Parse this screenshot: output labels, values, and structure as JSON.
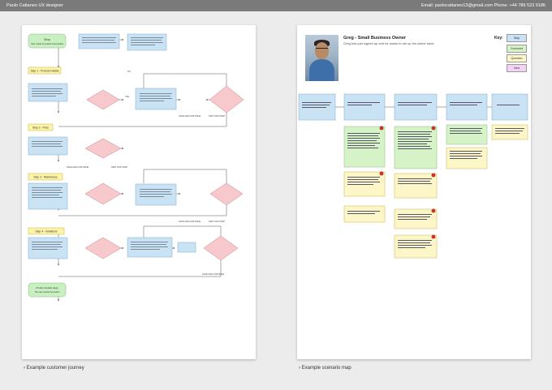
{
  "header": {
    "left": "Paolo Cattaneo UX designer",
    "right": "Email: paolocattaneo13@gmail.com Phone: +44 786 523 9186"
  },
  "captions": {
    "left": "Example customer journey",
    "right": "Example scenario map"
  },
  "journey": {
    "start": "Shop\nUser needs to product new product",
    "step1": "Step 1 - Product Details",
    "step2": "Step 2 - Price",
    "step3": "Step 3 - Warehouse",
    "step4": "Step 4 - Variations",
    "end": "Product details page\nThe user reviews the product and its variants",
    "save_continue": "SAVE AND CONTINUE",
    "skip_step": "SKIP THIS STEP",
    "no": "NO",
    "yes": "YES"
  },
  "scenario": {
    "title": "Greg - Small Business Owner",
    "subtitle": "Greg has just signed up and he wants to set up his online store",
    "key_label": "Key:",
    "key": [
      "Step",
      "Comment",
      "Question",
      "Idea"
    ],
    "colors": {
      "step": "#c9e3f5",
      "comment": "#d6f3c7",
      "question": "#fdf6c8",
      "idea": "#f3d3f3",
      "decision": "#f7c9cc",
      "start": "#c8f0c0"
    }
  }
}
